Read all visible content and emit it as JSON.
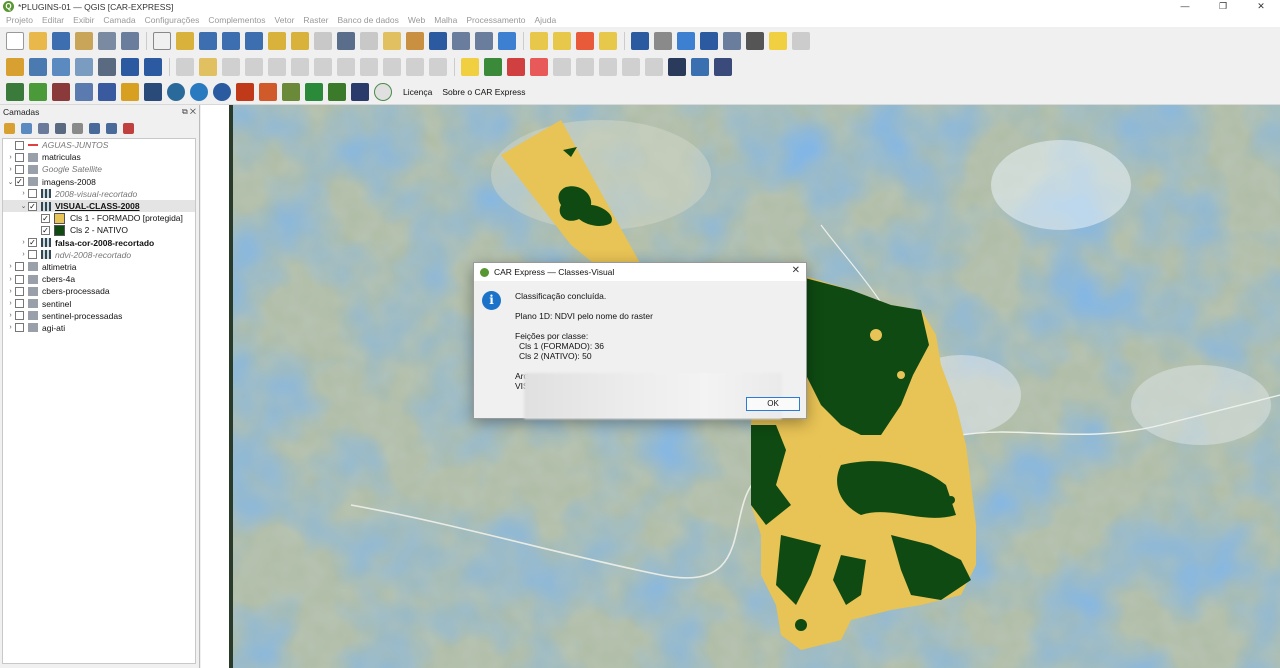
{
  "window": {
    "title": "*PLUGINS-01 — QGIS [CAR-EXPRESS]",
    "minimize": "—",
    "maximize": "❐",
    "close": "✕"
  },
  "menu": [
    "Projeto",
    "Editar",
    "Exibir",
    "Camada",
    "Configurações",
    "Complementos",
    "Vetor",
    "Raster",
    "Banco de dados",
    "Web",
    "Malha",
    "Processamento",
    "Ajuda"
  ],
  "plugin_toolbar": {
    "license_label": "Licença",
    "about_label": "Sobre o CAR Express"
  },
  "layers_panel": {
    "title": "Camadas",
    "items": [
      {
        "label": "AGUAS-JUNTOS",
        "style": "italic",
        "checked": false,
        "expand": "",
        "icon": "line-red"
      },
      {
        "label": "matriculas",
        "style": "normal",
        "checked": false,
        "expand": "›",
        "icon": "group"
      },
      {
        "label": "Google Satellite",
        "style": "italic",
        "checked": false,
        "expand": "›",
        "icon": "group"
      },
      {
        "label": "imagens-2008",
        "style": "normal",
        "checked": true,
        "expand": "⌄",
        "icon": "group"
      },
      {
        "label": "2008-visual-recortado",
        "style": "italic",
        "checked": false,
        "expand": "›",
        "icon": "raster"
      },
      {
        "label": "VISUAL-CLASS-2008",
        "style": "underline",
        "checked": true,
        "expand": "⌄",
        "icon": "raster"
      },
      {
        "label": "Cls 1 - FORMADO [protegida]",
        "style": "normal",
        "checked": true,
        "expand": "",
        "icon": "swatch-yellow"
      },
      {
        "label": "Cls 2 - NATIVO",
        "style": "normal",
        "checked": true,
        "expand": "",
        "icon": "swatch-green"
      },
      {
        "label": "falsa-cor-2008-recortado",
        "style": "bold",
        "checked": true,
        "expand": "›",
        "icon": "raster"
      },
      {
        "label": "ndvi-2008-recortado",
        "style": "italic",
        "checked": false,
        "expand": "›",
        "icon": "raster"
      },
      {
        "label": "altimetria",
        "style": "normal",
        "checked": false,
        "expand": "›",
        "icon": "group"
      },
      {
        "label": "cbers-4a",
        "style": "normal",
        "checked": false,
        "expand": "›",
        "icon": "group"
      },
      {
        "label": "cbers-processada",
        "style": "normal",
        "checked": false,
        "expand": "›",
        "icon": "group"
      },
      {
        "label": "sentinel",
        "style": "normal",
        "checked": false,
        "expand": "›",
        "icon": "group"
      },
      {
        "label": "sentinel-processadas",
        "style": "normal",
        "checked": false,
        "expand": "›",
        "icon": "group"
      },
      {
        "label": "agi-ati",
        "style": "normal",
        "checked": false,
        "expand": "›",
        "icon": "group"
      }
    ]
  },
  "dialog": {
    "title": "CAR Express — Classes-Visual",
    "line1": "Classificação concluída.",
    "line2": "Plano 1D: NDVI pelo nome do raster",
    "line3": "Feições por classe:",
    "line4": "  Cls 1 (FORMADO): 36",
    "line5": "  Cls 2 (NATIVO): 50",
    "line6": "Arq",
    "line7": "VIS",
    "ok_label": "OK"
  },
  "colors": {
    "class_formado": "#e8c355",
    "class_nativo": "#0e4a12",
    "water_blue": "#3a78c8"
  }
}
